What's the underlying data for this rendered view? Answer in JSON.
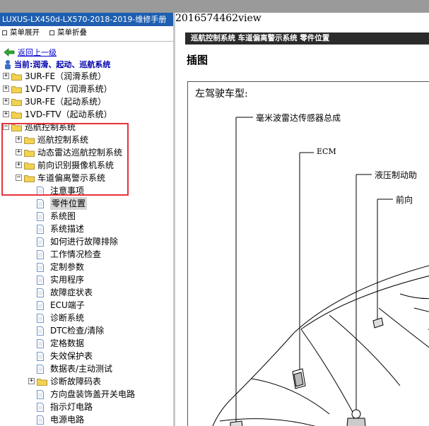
{
  "window": {
    "title": "LUXUS-LX450d-LX570-2018-2019-维修手册"
  },
  "left_menu": {
    "expand_label": "菜单展开",
    "collapse_label": "菜单折叠"
  },
  "nav": {
    "back_label": "返回上一级",
    "current_label": "当前:润滑、起动、巡航系统"
  },
  "tree": [
    {
      "label": "3UR-FE（润滑系统）",
      "level": 0,
      "type": "folder",
      "expand": "+"
    },
    {
      "label": "1VD-FTV（润滑系统）",
      "level": 0,
      "type": "folder",
      "expand": "+"
    },
    {
      "label": "3UR-FE（起动系统）",
      "level": 0,
      "type": "folder",
      "expand": "+"
    },
    {
      "label": "1VD-FTV（起动系统）",
      "level": 0,
      "type": "folder",
      "expand": "+"
    },
    {
      "label": "巡航控制系统",
      "level": 0,
      "type": "folder",
      "expand": "-"
    },
    {
      "label": "巡航控制系统",
      "level": 1,
      "type": "folder",
      "expand": "+"
    },
    {
      "label": "动态雷达巡航控制系统",
      "level": 1,
      "type": "folder",
      "expand": "+"
    },
    {
      "label": "前向识别摄像机系统",
      "level": 1,
      "type": "folder",
      "expand": "+"
    },
    {
      "label": "车道偏离警示系统",
      "level": 1,
      "type": "folder",
      "expand": "-"
    },
    {
      "label": "注意事项",
      "level": 2,
      "type": "doc"
    },
    {
      "label": "零件位置",
      "level": 2,
      "type": "doc",
      "selected": true
    },
    {
      "label": "系统图",
      "level": 2,
      "type": "doc"
    },
    {
      "label": "系统描述",
      "level": 2,
      "type": "doc"
    },
    {
      "label": "如何进行故障排除",
      "level": 2,
      "type": "doc"
    },
    {
      "label": "工作情况检查",
      "level": 2,
      "type": "doc"
    },
    {
      "label": "定制参数",
      "level": 2,
      "type": "doc"
    },
    {
      "label": "实用程序",
      "level": 2,
      "type": "doc"
    },
    {
      "label": "故障症状表",
      "level": 2,
      "type": "doc"
    },
    {
      "label": "ECU端子",
      "level": 2,
      "type": "doc"
    },
    {
      "label": "诊断系统",
      "level": 2,
      "type": "doc"
    },
    {
      "label": "DTC检查/清除",
      "level": 2,
      "type": "doc"
    },
    {
      "label": "定格数据",
      "level": 2,
      "type": "doc"
    },
    {
      "label": "失效保护表",
      "level": 2,
      "type": "doc"
    },
    {
      "label": "数据表/主动测试",
      "level": 2,
      "type": "doc"
    },
    {
      "label": "诊断故障码表",
      "level": 2,
      "type": "folder",
      "expand": "+"
    },
    {
      "label": "方向盘装饰盖开关电路",
      "level": 2,
      "type": "doc"
    },
    {
      "label": "指示灯电路",
      "level": 2,
      "type": "doc"
    },
    {
      "label": "电源电路",
      "level": 2,
      "type": "doc"
    }
  ],
  "doc": {
    "page_id": "2016574462view",
    "breadcrumb": "巡航控制系统  车道偏离警示系统  零件位置",
    "section_title": "插图",
    "figure_caption": "左驾驶车型:",
    "callouts": [
      "毫米波雷达传感器总成",
      "ECM",
      "液压制动助",
      "前向"
    ]
  },
  "colors": {
    "title_bar": "#1f5fb0",
    "highlight_box": "#e8323c",
    "header_bar": "#2b2b2b",
    "folder": "#f3d24f"
  }
}
